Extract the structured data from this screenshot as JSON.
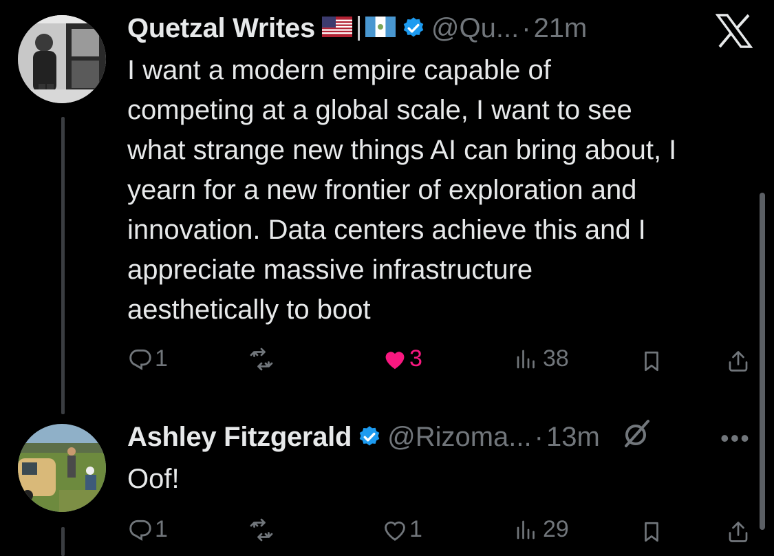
{
  "tweet1": {
    "name": "Quetzal Writes",
    "flag_us": "🇺🇸",
    "flag_gt": "🇬🇹",
    "handle": "@Qu...",
    "dot": "·",
    "time": "21m",
    "text": "I want a modern empire capable of\ncompeting at a global scale, I want to see\nwhat strange new things AI can bring about, I\nyearn for a new frontier of exploration and\ninnovation. Data centers achieve this and I\nappreciate massive infrastructure\naesthetically to boot",
    "replies": "1",
    "retweets": "",
    "likes": "3",
    "views": "38",
    "liked": true
  },
  "tweet2": {
    "name": "Ashley Fitzgerald",
    "handle": "@Rizoma...",
    "dot": "·",
    "time": "13m",
    "text": "Oof!",
    "replies": "1",
    "retweets": "",
    "likes": "1",
    "views": "29",
    "liked": false
  },
  "colors": {
    "background": "#000000",
    "text": "#e7e9ea",
    "muted": "#71767b",
    "verified": "#1d9bf0",
    "like": "#f91880"
  },
  "icons": [
    "x-logo-icon",
    "verified-badge-icon",
    "reply-icon",
    "retweet-icon",
    "like-icon",
    "views-icon",
    "bookmark-icon",
    "share-icon",
    "grok-icon",
    "more-icon"
  ]
}
